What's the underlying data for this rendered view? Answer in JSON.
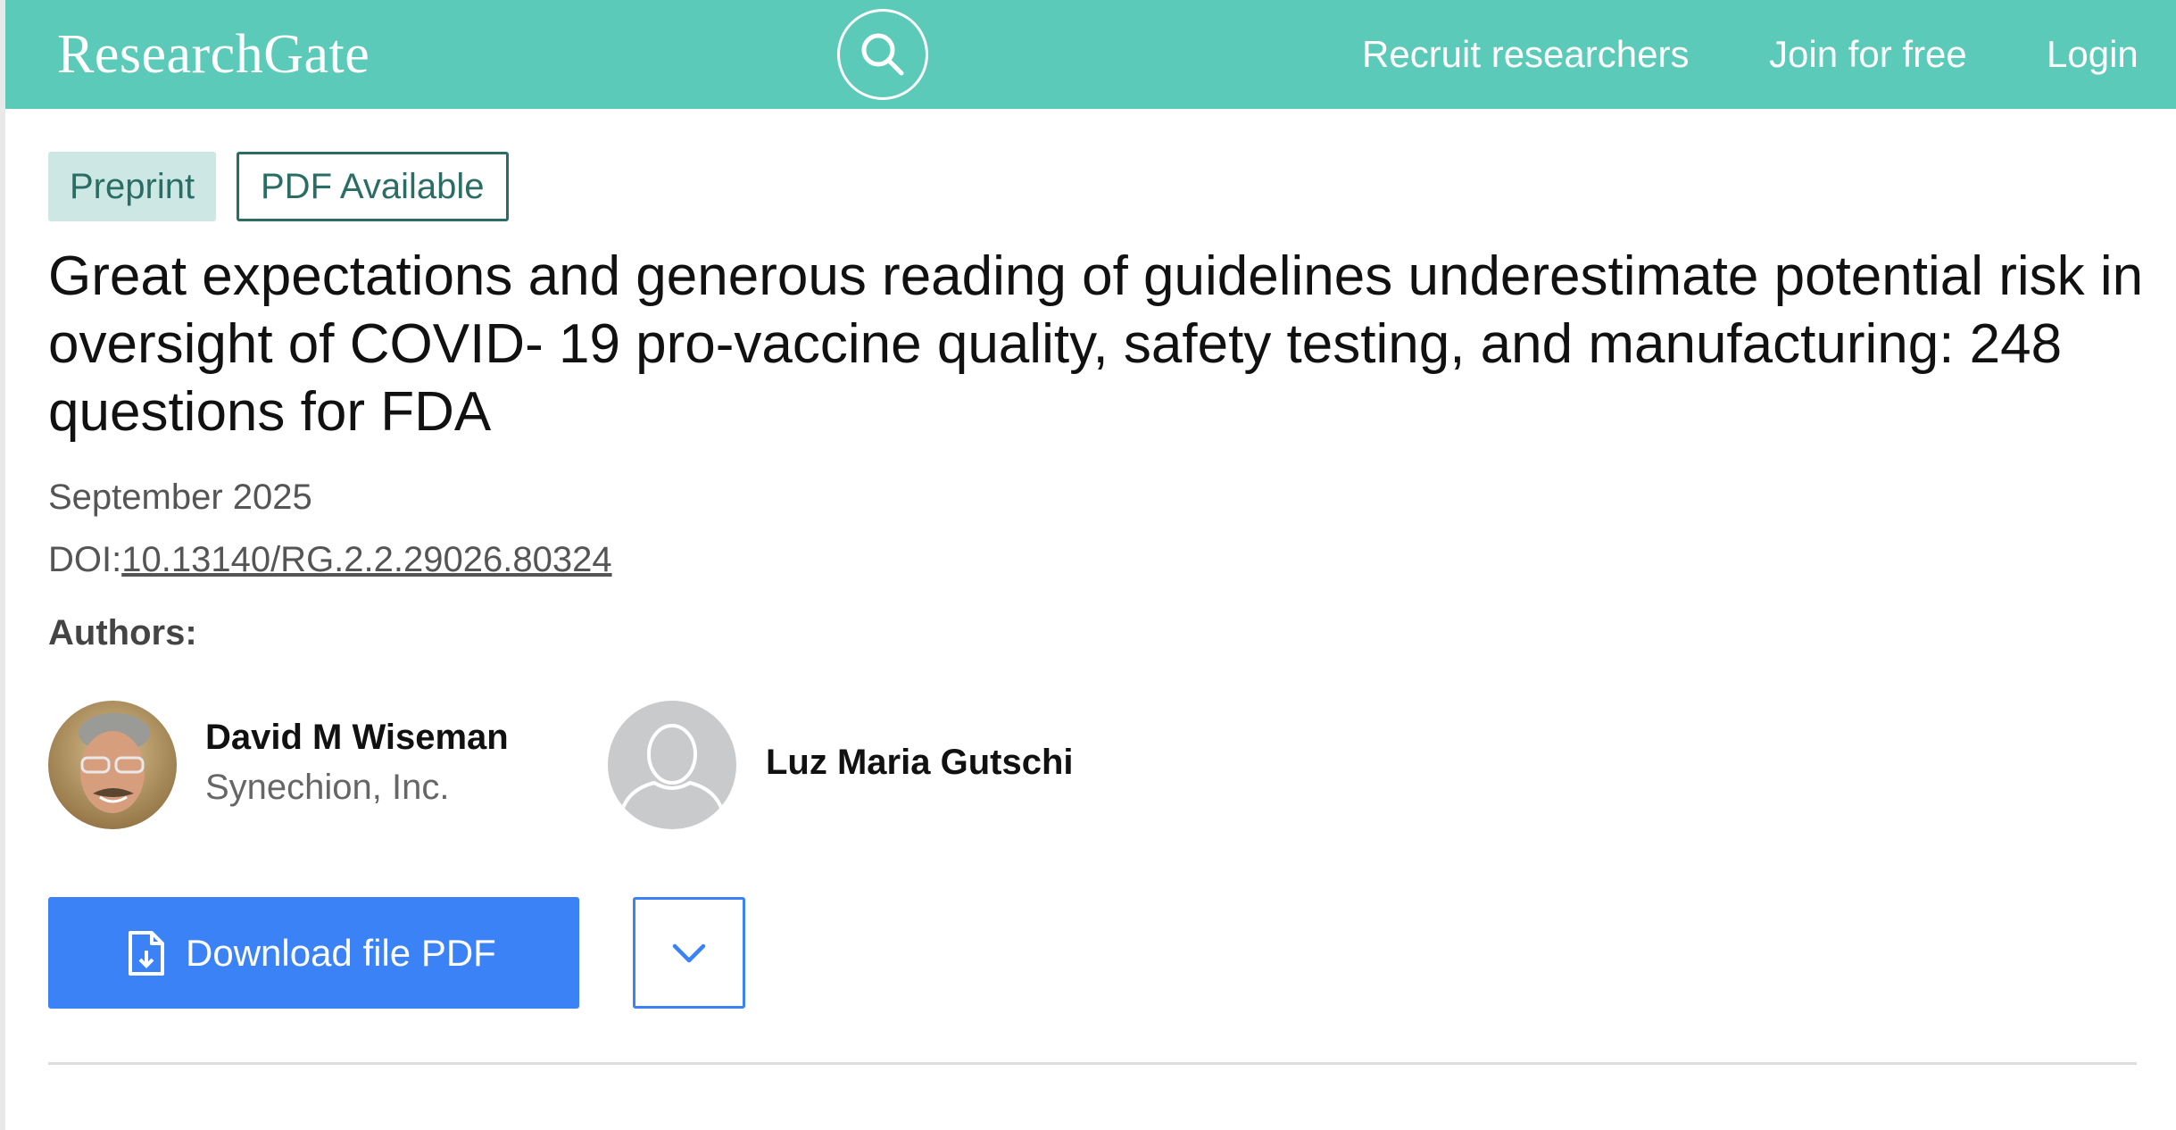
{
  "header": {
    "logo": "ResearchGate",
    "nav": {
      "recruit": "Recruit researchers",
      "join": "Join for free",
      "login": "Login"
    },
    "background_color": "#5ccab9"
  },
  "badges": {
    "preprint": "Preprint",
    "pdf": "PDF Available"
  },
  "publication": {
    "title": "Great expectations and generous reading of guidelines underestimate potential risk in oversight of COVID- 19 pro-vaccine quality, safety testing, and manufacturing: 248 questions for FDA",
    "date": "September 2025",
    "doi_label": "DOI:",
    "doi": "10.13140/RG.2.2.29026.80324"
  },
  "authors": {
    "label": "Authors:",
    "list": [
      {
        "name": "David M Wiseman",
        "affiliation": "Synechion, Inc.",
        "avatar": "photo"
      },
      {
        "name": "Luz Maria Gutschi",
        "affiliation": "",
        "avatar": "placeholder"
      }
    ]
  },
  "actions": {
    "download_label": "Download file PDF",
    "download_icon": "file-download-icon",
    "more_icon": "chevron-down-icon",
    "accent_color": "#3b82f6"
  }
}
